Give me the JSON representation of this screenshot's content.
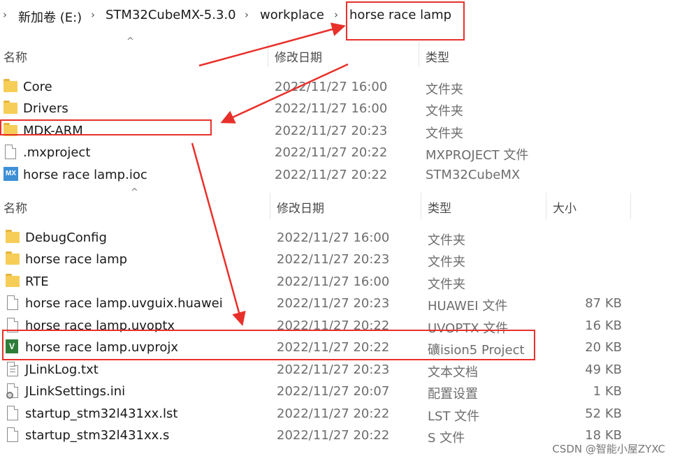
{
  "breadcrumb": [
    "新加卷 (E:)",
    "STM32CubeMX-5.3.0",
    "workplace",
    "horse race lamp"
  ],
  "top_pane": {
    "columns": {
      "name": "名称",
      "modified": "修改日期",
      "type": "类型"
    },
    "rows": [
      {
        "name": "Core",
        "modified": "2022/11/27 16:00",
        "type": "文件夹",
        "icon": "folder-icon"
      },
      {
        "name": "Drivers",
        "modified": "2022/11/27 16:00",
        "type": "文件夹",
        "icon": "folder-icon"
      },
      {
        "name": "MDK-ARM",
        "modified": "2022/11/27 20:23",
        "type": "文件夹",
        "icon": "folder-icon"
      },
      {
        "name": ".mxproject",
        "modified": "2022/11/27 20:22",
        "type": "MXPROJECT 文件",
        "icon": "file-icon"
      },
      {
        "name": "horse race lamp.ioc",
        "modified": "2022/11/27 20:22",
        "type": "STM32CubeMX",
        "icon": "cubemx-icon"
      }
    ]
  },
  "bottom_pane": {
    "columns": {
      "name": "名称",
      "modified": "修改日期",
      "type": "类型",
      "size": "大小"
    },
    "rows": [
      {
        "name": "DebugConfig",
        "modified": "2022/11/27 16:00",
        "type": "文件夹",
        "size": "",
        "icon": "folder-icon"
      },
      {
        "name": "horse race lamp",
        "modified": "2022/11/27 20:23",
        "type": "文件夹",
        "size": "",
        "icon": "folder-icon"
      },
      {
        "name": "RTE",
        "modified": "2022/11/27 16:00",
        "type": "文件夹",
        "size": "",
        "icon": "folder-icon"
      },
      {
        "name": "horse race lamp.uvguix.huawei",
        "modified": "2022/11/27 20:23",
        "type": "HUAWEI 文件",
        "size": "87 KB",
        "icon": "file-icon"
      },
      {
        "name": "horse race lamp.uvoptx",
        "modified": "2022/11/27 20:22",
        "type": "UVOPTX 文件",
        "size": "16 KB",
        "icon": "file-icon"
      },
      {
        "name": "horse race lamp.uvprojx",
        "modified": "2022/11/27 20:22",
        "type": "礦ision5 Project",
        "size": "20 KB",
        "icon": "uvision-icon"
      },
      {
        "name": "JLinkLog.txt",
        "modified": "2022/11/27 20:23",
        "type": "文本文档",
        "size": "49 KB",
        "icon": "text-file-icon"
      },
      {
        "name": "JLinkSettings.ini",
        "modified": "2022/11/27 20:07",
        "type": "配置设置",
        "size": "1 KB",
        "icon": "settings-file-icon"
      },
      {
        "name": "startup_stm32l431xx.lst",
        "modified": "2022/11/27 20:22",
        "type": "LST 文件",
        "size": "52 KB",
        "icon": "file-icon"
      },
      {
        "name": "startup_stm32l431xx.s",
        "modified": "2022/11/27 20:22",
        "type": "S 文件",
        "size": "18 KB",
        "icon": "file-icon"
      }
    ]
  },
  "annotation_color": "#e8302a",
  "watermark": "CSDN @智能小屋ZYXC"
}
